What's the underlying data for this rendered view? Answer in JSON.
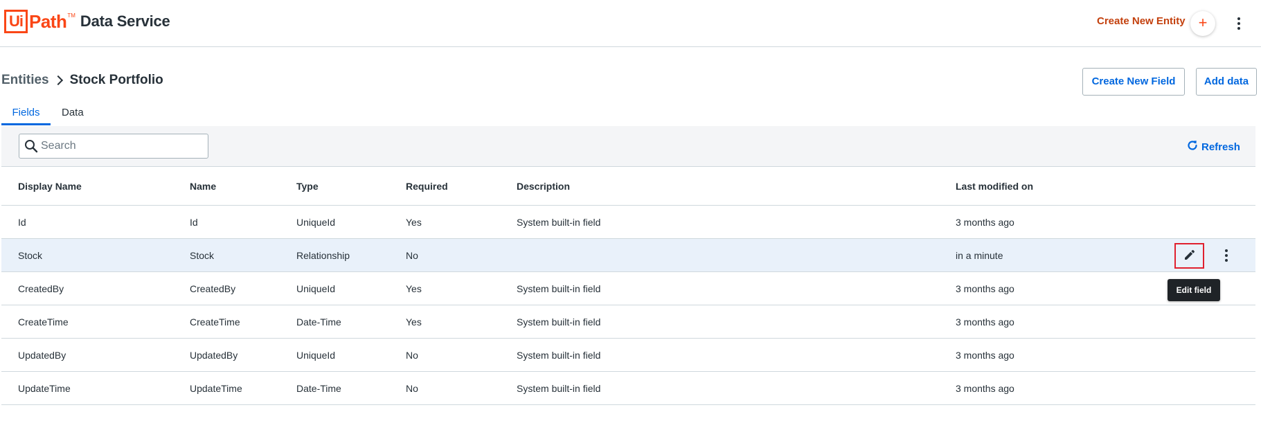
{
  "header": {
    "logo_ui": "Ui",
    "logo_path": "Path",
    "logo_tm": "TM",
    "app_name": "Data Service",
    "create_entity_label": "Create New Entity",
    "create_plus": "+"
  },
  "breadcrumb": {
    "root": "Entities",
    "current": "Stock Portfolio"
  },
  "actions": {
    "create_field": "Create New Field",
    "add_data": "Add data"
  },
  "tabs": [
    {
      "label": "Fields",
      "active": true
    },
    {
      "label": "Data",
      "active": false
    }
  ],
  "toolbar": {
    "search_placeholder": "Search",
    "refresh_label": "Refresh"
  },
  "table": {
    "columns": [
      "Display Name",
      "Name",
      "Type",
      "Required",
      "Description",
      "Last modified on"
    ],
    "rows": [
      {
        "display_name": "Id",
        "name": "Id",
        "type": "UniqueId",
        "required": "Yes",
        "description": "System built-in field",
        "modified": "3 months ago"
      },
      {
        "display_name": "Stock",
        "name": "Stock",
        "type": "Relationship",
        "required": "No",
        "description": "",
        "modified": "in a minute"
      },
      {
        "display_name": "CreatedBy",
        "name": "CreatedBy",
        "type": "UniqueId",
        "required": "Yes",
        "description": "System built-in field",
        "modified": "3 months ago"
      },
      {
        "display_name": "CreateTime",
        "name": "CreateTime",
        "type": "Date-Time",
        "required": "Yes",
        "description": "System built-in field",
        "modified": "3 months ago"
      },
      {
        "display_name": "UpdatedBy",
        "name": "UpdatedBy",
        "type": "UniqueId",
        "required": "No",
        "description": "System built-in field",
        "modified": "3 months ago"
      },
      {
        "display_name": "UpdateTime",
        "name": "UpdateTime",
        "type": "Date-Time",
        "required": "No",
        "description": "System built-in field",
        "modified": "3 months ago"
      }
    ]
  },
  "tooltip": {
    "text": "Edit field"
  },
  "icons": {
    "search": "search-icon",
    "refresh": "refresh-icon",
    "edit": "pencil-icon",
    "more": "more-vertical-icon",
    "chevron": "chevron-right-icon"
  },
  "colors": {
    "brand": "#fa4616",
    "accent": "#0067df",
    "create_entity": "#c3400d",
    "selected_row": "#e9f1fa",
    "edit_highlight": "#e0202e"
  }
}
